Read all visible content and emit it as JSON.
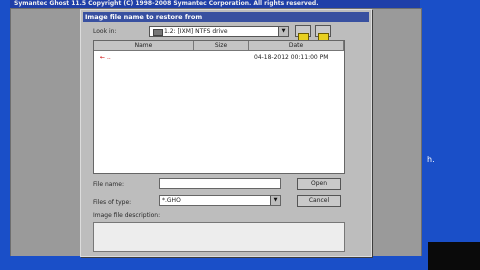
{
  "background_app": {
    "title": "Symantec Ghost 11.5   Copyright (C) 1998-2008 Symantec Corporation. All rights reserved.",
    "side_text": "h."
  },
  "dialog": {
    "title": "Image file name to restore from",
    "look_in": {
      "label": "Look in:",
      "value": "1.2: [IXM] NTFS drive"
    },
    "columns": [
      "Name",
      "Size",
      "Date"
    ],
    "rows": [
      {
        "name": "..",
        "size": "",
        "date": "04-18-2012 00:11:00 PM"
      }
    ],
    "file_name": {
      "label": "File name:",
      "value": ""
    },
    "files_of_type": {
      "label": "Files of type:",
      "value": "*.GHO"
    },
    "open_label": "Open",
    "cancel_label": "Cancel",
    "description_label": "Image file description:",
    "description_value": ""
  },
  "colors": {
    "desktop": "#1a4fc8",
    "title_bar": "#3850a0",
    "dialog_face": "#bdbdbd"
  },
  "icons": [
    "drive-icon",
    "parent-folder-icon",
    "new-folder-icon",
    "dropdown-arrow-icon",
    "cursor-icon"
  ]
}
